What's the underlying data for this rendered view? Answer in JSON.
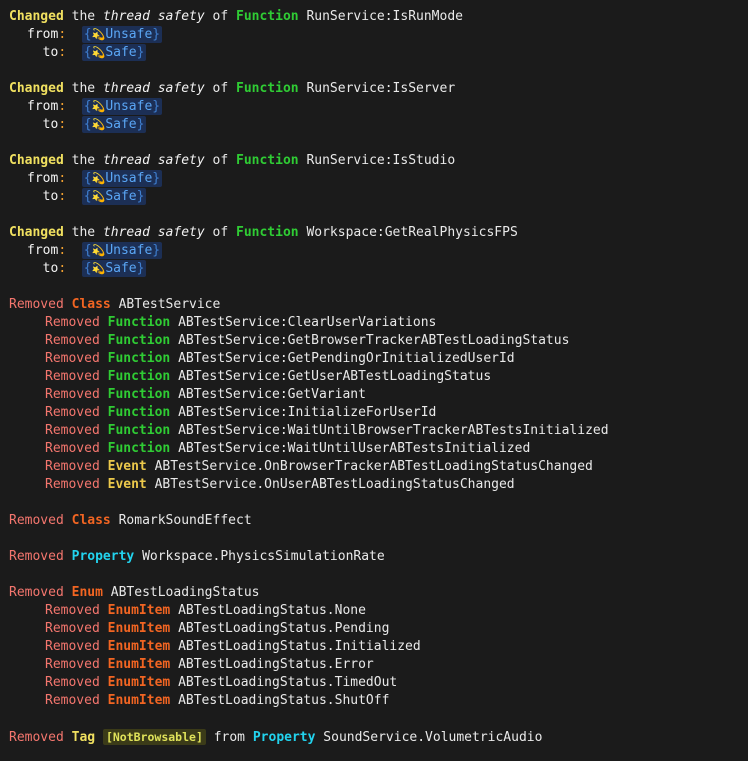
{
  "theme": {
    "background": "#1b1b1b",
    "text": "#e8e8e8",
    "changed_color": "#f0e060",
    "removed_color": "#f4766e",
    "function_color": "#2fcc34",
    "class_color": "#f26522",
    "event_color": "#ecc94b",
    "property_color": "#22d3ee",
    "enum_color": "#f26522",
    "tag_color": "#f0e060",
    "separator_color": "#f0a030",
    "badge_bg": "#1c2f55",
    "badge_text": "#4f9bf0",
    "tag_badge_bg": "#3b3b18",
    "tag_badge_text": "#dfe25a"
  },
  "labels": {
    "changed": "Changed",
    "removed": "Removed",
    "the": "the",
    "thread_safety": "thread safety",
    "of": "of",
    "from_label": "from",
    "to_label": "to",
    "from_word": "from",
    "colon": ":",
    "kw_function": "Function",
    "kw_class": "Class",
    "kw_event": "Event",
    "kw_property": "Property",
    "kw_enum": "Enum",
    "kw_enumitem": "EnumItem",
    "kw_tag": "Tag",
    "brace_open": "{",
    "brace_close": "}",
    "glyph": "💫",
    "unsafe": "Unsafe",
    "safe": "Safe",
    "tag_notbrowsable": "[NotBrowsable]"
  },
  "changed_blocks": [
    {
      "member": "RunService:IsRunMode",
      "from": "Unsafe",
      "to": "Safe"
    },
    {
      "member": "RunService:IsServer",
      "from": "Unsafe",
      "to": "Safe"
    },
    {
      "member": "RunService:IsStudio",
      "from": "Unsafe",
      "to": "Safe"
    },
    {
      "member": "Workspace:GetRealPhysicsFPS",
      "from": "Unsafe",
      "to": "Safe"
    }
  ],
  "removed_class_abtest": {
    "class_name": "ABTestService",
    "members": [
      {
        "kind": "Function",
        "name": "ABTestService:ClearUserVariations"
      },
      {
        "kind": "Function",
        "name": "ABTestService:GetBrowserTrackerABTestLoadingStatus"
      },
      {
        "kind": "Function",
        "name": "ABTestService:GetPendingOrInitializedUserId"
      },
      {
        "kind": "Function",
        "name": "ABTestService:GetUserABTestLoadingStatus"
      },
      {
        "kind": "Function",
        "name": "ABTestService:GetVariant"
      },
      {
        "kind": "Function",
        "name": "ABTestService:InitializeForUserId"
      },
      {
        "kind": "Function",
        "name": "ABTestService:WaitUntilBrowserTrackerABTestsInitialized"
      },
      {
        "kind": "Function",
        "name": "ABTestService:WaitUntilUserABTestsInitialized"
      },
      {
        "kind": "Event",
        "name": "ABTestService.OnBrowserTrackerABTestLoadingStatusChanged"
      },
      {
        "kind": "Event",
        "name": "ABTestService.OnUserABTestLoadingStatusChanged"
      }
    ]
  },
  "removed_class_romark": {
    "class_name": "RomarkSoundEffect"
  },
  "removed_property": {
    "name": "Workspace.PhysicsSimulationRate"
  },
  "removed_enum": {
    "enum_name": "ABTestLoadingStatus",
    "items": [
      "ABTestLoadingStatus.None",
      "ABTestLoadingStatus.Pending",
      "ABTestLoadingStatus.Initialized",
      "ABTestLoadingStatus.Error",
      "ABTestLoadingStatus.TimedOut",
      "ABTestLoadingStatus.ShutOff"
    ]
  },
  "removed_tag": {
    "tag": "[NotBrowsable]",
    "target": "SoundService.VolumetricAudio"
  }
}
